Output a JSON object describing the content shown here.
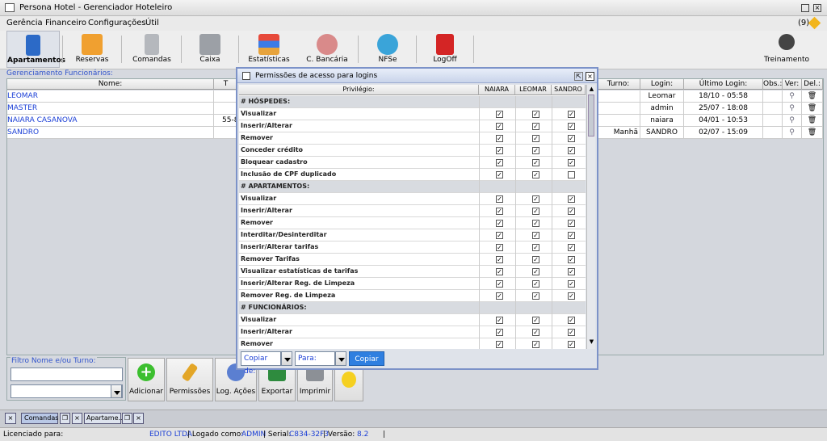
{
  "window": {
    "title": "Persona Hotel - Gerenciador Hoteleiro",
    "notifications": "(9)"
  },
  "menu": [
    "Gerência",
    "Financeiro",
    "Configurações",
    "Útil"
  ],
  "toolbar": {
    "items": [
      "Apartamentos",
      "Reservas",
      "Comandas",
      "Caixa",
      "Estatísticas",
      "C. Bancária",
      "NFSe",
      "LogOff"
    ],
    "right": "Treinamento"
  },
  "main": {
    "title": "Gerenciamento Funcionários:",
    "columns": [
      "Nome:",
      "T",
      "Turno:",
      "Login:",
      "Último Login:",
      "Obs.:",
      "Ver:",
      "Del.:"
    ],
    "rows": [
      {
        "nome": "LEOMAR",
        "t": "",
        "turno": "",
        "login": "Leomar",
        "ultimo": "18/10 - 05:58"
      },
      {
        "nome": "MASTER",
        "t": "",
        "turno": "",
        "login": "admin",
        "ultimo": "25/07 - 18:08"
      },
      {
        "nome": "NAIARA CASANOVA",
        "t": "55-8",
        "turno": "",
        "login": "naiara",
        "ultimo": "04/01 - 10:53"
      },
      {
        "nome": "SANDRO",
        "t": "",
        "turno": "Manhã",
        "login": "SANDRO",
        "ultimo": "02/07 - 15:09"
      }
    ]
  },
  "filter": {
    "label": "Filtro Nome e/ou Turno:"
  },
  "actions": [
    "Adicionar",
    "Permissões",
    "Log. Ações",
    "Exportar",
    "Imprimir"
  ],
  "taskbar": [
    "Comandas",
    "Apartame..."
  ],
  "status": {
    "licensed_label": "Licenciado para:",
    "company": "EDITO LTDA",
    "logged_label": "| Logado como:",
    "user": "ADMIN",
    "serial_label": "| Serial:",
    "serial": "C834-32F3",
    "version_label": "| Versão:",
    "version": "8.2",
    "sep": "|"
  },
  "dialog": {
    "title": "Permissões de acesso para logins",
    "columns": [
      "Privilégio:",
      "NAIARA",
      "LEOMAR",
      "SANDRO"
    ],
    "rows": [
      {
        "label": "# HÓSPEDES:",
        "section": true
      },
      {
        "label": "Visualizar",
        "v": [
          1,
          1,
          1
        ]
      },
      {
        "label": "Inserir/Alterar",
        "v": [
          1,
          1,
          1
        ]
      },
      {
        "label": "Remover",
        "v": [
          1,
          1,
          1
        ]
      },
      {
        "label": "Conceder crédito",
        "v": [
          1,
          1,
          1
        ]
      },
      {
        "label": "Bloquear cadastro",
        "v": [
          1,
          1,
          1
        ]
      },
      {
        "label": "Inclusão de CPF duplicado",
        "v": [
          1,
          1,
          0
        ]
      },
      {
        "label": "# APARTAMENTOS:",
        "section": true
      },
      {
        "label": "Visualizar",
        "v": [
          1,
          1,
          1
        ]
      },
      {
        "label": "Inserir/Alterar",
        "v": [
          1,
          1,
          1
        ]
      },
      {
        "label": "Remover",
        "v": [
          1,
          1,
          1
        ]
      },
      {
        "label": "Interditar/Desinterditar",
        "v": [
          1,
          1,
          1
        ]
      },
      {
        "label": "Inserir/Alterar tarifas",
        "v": [
          1,
          1,
          1
        ]
      },
      {
        "label": "Remover Tarifas",
        "v": [
          1,
          1,
          1
        ]
      },
      {
        "label": "Visualizar estatísticas de tarifas",
        "v": [
          1,
          1,
          1
        ]
      },
      {
        "label": "Inserir/Alterar Reg. de Limpeza",
        "v": [
          1,
          1,
          1
        ]
      },
      {
        "label": "Remover Reg. de Limpeza",
        "v": [
          1,
          1,
          1
        ]
      },
      {
        "label": "# FUNCIONÁRIOS:",
        "section": true
      },
      {
        "label": "Visualizar",
        "v": [
          1,
          1,
          1
        ]
      },
      {
        "label": "Inserir/Alterar",
        "v": [
          1,
          1,
          1
        ]
      },
      {
        "label": "Remover",
        "v": [
          1,
          1,
          1
        ]
      }
    ],
    "copy_from": "Copiar de:",
    "copy_to": "Para:",
    "copy_button": "Copiar"
  }
}
